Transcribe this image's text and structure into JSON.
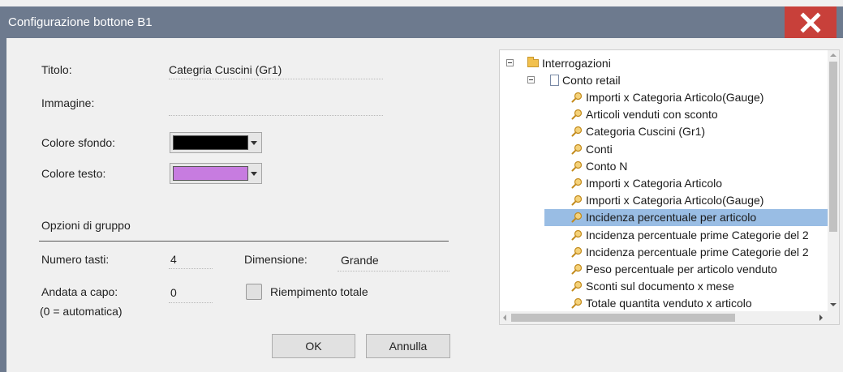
{
  "dialog": {
    "title": "Configurazione bottone B1",
    "close_icon": "close-x-icon"
  },
  "form": {
    "titolo_label": "Titolo:",
    "titolo_value": "Categria Cuscini (Gr1)",
    "immagine_label": "Immagine:",
    "immagine_value": "",
    "colore_sfondo_label": "Colore sfondo:",
    "colore_sfondo_value": "#000000",
    "colore_testo_label": "Colore testo:",
    "colore_testo_value": "#c77ce0"
  },
  "group": {
    "heading": "Opzioni di gruppo",
    "numero_tasti_label": "Numero tasti:",
    "numero_tasti_value": "4",
    "dimensione_label": "Dimensione:",
    "dimensione_value": "Grande",
    "andata_label": "Andata a capo:",
    "andata_hint": "(0 = automatica)",
    "andata_value": "0",
    "riempimento_label": "Riempimento totale",
    "riempimento_checked": false
  },
  "buttons": {
    "ok": "OK",
    "annulla": "Annulla"
  },
  "tree": {
    "root": "Interrogazioni",
    "child": "Conto retail",
    "items": [
      "Importi x Categoria Articolo(Gauge)",
      "Articoli venduti con sconto",
      "Categoria Cuscini (Gr1)",
      "Conti",
      "Conto N",
      "Importi x Categoria Articolo",
      "Importi x Categoria Articolo(Gauge)",
      "Incidenza percentuale per articolo",
      "Incidenza percentuale prime Categorie del 2",
      "Incidenza percentuale prime Categorie del 2",
      "Peso percentuale per articolo venduto",
      "Sconti sul documento x mese",
      "Totale quantita venduto x articolo"
    ],
    "selected_index": 7,
    "selection_color": "#99bde4"
  }
}
